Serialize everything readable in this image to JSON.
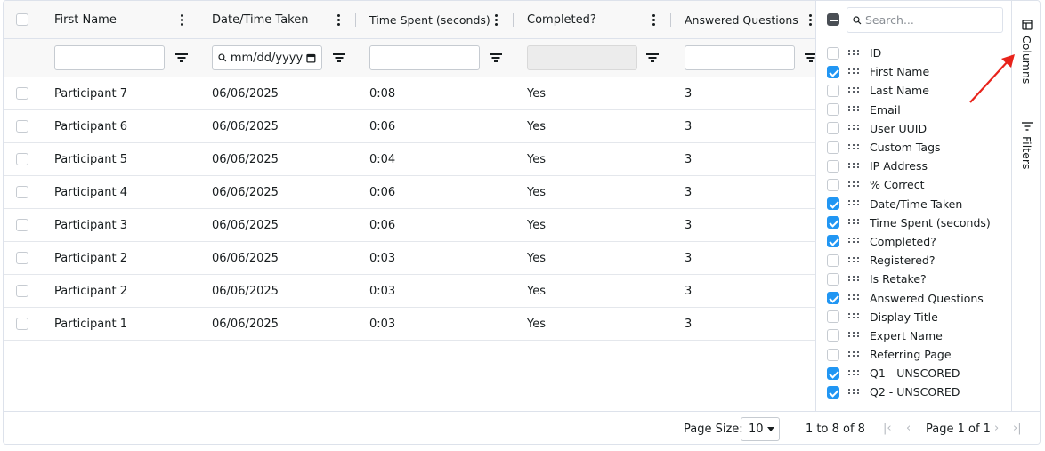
{
  "header": {
    "columns": [
      {
        "label": "First Name"
      },
      {
        "label": "Date/Time Taken"
      },
      {
        "label": "Time Spent (seconds)"
      },
      {
        "label": "Completed?"
      },
      {
        "label": "Answered Questions"
      }
    ]
  },
  "filters": {
    "date_placeholder": "mm/dd/yyyy"
  },
  "rows": [
    {
      "first_name": "Participant 7",
      "date": "06/06/2025",
      "time": "0:08",
      "completed": "Yes",
      "answered": "3"
    },
    {
      "first_name": "Participant 6",
      "date": "06/06/2025",
      "time": "0:06",
      "completed": "Yes",
      "answered": "3"
    },
    {
      "first_name": "Participant 5",
      "date": "06/06/2025",
      "time": "0:04",
      "completed": "Yes",
      "answered": "3"
    },
    {
      "first_name": "Participant 4",
      "date": "06/06/2025",
      "time": "0:06",
      "completed": "Yes",
      "answered": "3"
    },
    {
      "first_name": "Participant 3",
      "date": "06/06/2025",
      "time": "0:06",
      "completed": "Yes",
      "answered": "3"
    },
    {
      "first_name": "Participant 2",
      "date": "06/06/2025",
      "time": "0:03",
      "completed": "Yes",
      "answered": "3"
    },
    {
      "first_name": "Participant 2",
      "date": "06/06/2025",
      "time": "0:03",
      "completed": "Yes",
      "answered": "3"
    },
    {
      "first_name": "Participant 1",
      "date": "06/06/2025",
      "time": "0:03",
      "completed": "Yes",
      "answered": "3"
    }
  ],
  "columns_panel": {
    "search_placeholder": "Search...",
    "items": [
      {
        "label": "ID",
        "checked": false
      },
      {
        "label": "First Name",
        "checked": true
      },
      {
        "label": "Last Name",
        "checked": false
      },
      {
        "label": "Email",
        "checked": false
      },
      {
        "label": "User UUID",
        "checked": false
      },
      {
        "label": "Custom Tags",
        "checked": false
      },
      {
        "label": "IP Address",
        "checked": false
      },
      {
        "label": "% Correct",
        "checked": false
      },
      {
        "label": "Date/Time Taken",
        "checked": true
      },
      {
        "label": "Time Spent (seconds)",
        "checked": true
      },
      {
        "label": "Completed?",
        "checked": true
      },
      {
        "label": "Registered?",
        "checked": false
      },
      {
        "label": "Is Retake?",
        "checked": false
      },
      {
        "label": "Answered Questions",
        "checked": true
      },
      {
        "label": "Display Title",
        "checked": false
      },
      {
        "label": "Expert Name",
        "checked": false
      },
      {
        "label": "Referring Page",
        "checked": false
      },
      {
        "label": "Q1 - UNSCORED",
        "checked": true
      },
      {
        "label": "Q2 - UNSCORED",
        "checked": true
      }
    ]
  },
  "side_tabs": {
    "columns": "Columns",
    "filters": "Filters"
  },
  "footer": {
    "page_size_label": "Page Size:",
    "page_size_value": "10",
    "row_range": "1 to 8 of 8",
    "page_label": "Page 1 of 1"
  },
  "colors": {
    "accent": "#2196f3",
    "annotation_arrow": "#e8231b"
  },
  "icons": [
    "checkbox",
    "column-menu-icon",
    "filter-icon",
    "calendar-icon",
    "search-icon",
    "drag-handle-icon",
    "columns-icon",
    "filters-icon",
    "first-page-icon",
    "prev-page-icon",
    "next-page-icon",
    "last-page-icon"
  ]
}
